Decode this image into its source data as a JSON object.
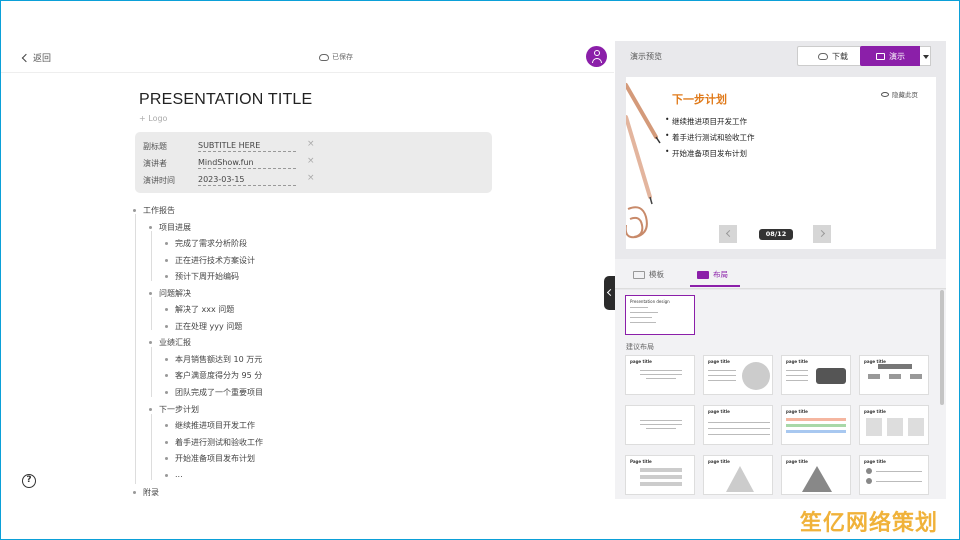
{
  "topbar": {
    "back_label": "返回",
    "saved_label": "已保存"
  },
  "doc": {
    "title": "PRESENTATION TITLE",
    "logo": "+ Logo",
    "meta": [
      {
        "key": "副标题",
        "value": "SUBTITLE HERE"
      },
      {
        "key": "演讲者",
        "value": "MindShow.fun"
      },
      {
        "key": "演讲时间",
        "value": "2023-03-15"
      }
    ],
    "outline": {
      "root": "工作报告",
      "sections": [
        {
          "title": "项目进展",
          "items": [
            "完成了需求分析阶段",
            "正在进行技术方案设计",
            "预计下周开始编码"
          ]
        },
        {
          "title": "问题解决",
          "items": [
            "解决了 xxx 问题",
            "正在处理 yyy 问题"
          ]
        },
        {
          "title": "业绩汇报",
          "items": [
            "本月销售额达到 10 万元",
            "客户满意度得分为 95 分",
            "团队完成了一个重要项目"
          ]
        },
        {
          "title": "下一步计划",
          "items": [
            "继续推进项目开发工作",
            "着手进行测试和验收工作",
            "开始准备项目发布计划",
            "..."
          ]
        }
      ],
      "appendix": "附录"
    }
  },
  "panel": {
    "preview_label": "演示预览",
    "download_label": "下载",
    "present_label": "演示",
    "slide": {
      "title": "下一步计划",
      "bullets": [
        "继续推进项目开发工作",
        "着手进行测试和验收工作",
        "开始准备项目发布计划"
      ],
      "hide_label": "隐藏此页",
      "pager": "08/12"
    },
    "tabs": [
      {
        "label": "模板"
      },
      {
        "label": "布局"
      }
    ],
    "suggest_label": "建议布局",
    "current_layout_title": "Presentation design",
    "thumb_title": "page title",
    "thumb_title_alt": "Page title"
  },
  "watermark": "笙亿网络策划",
  "colors": {
    "accent": "#8b1fa9",
    "slide_title": "#e07a1a",
    "panel_bg": "#e9e9ec"
  }
}
